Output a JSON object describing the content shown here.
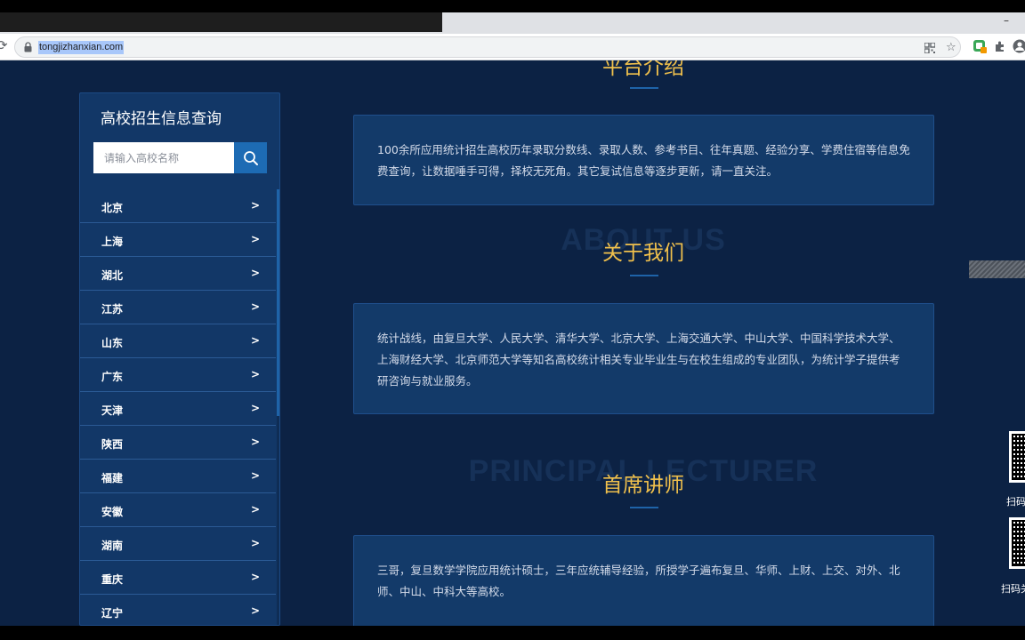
{
  "browser": {
    "url": "tongjizhanxian.com",
    "minimize_glyph": "–"
  },
  "sidebar": {
    "title": "高校招生信息查询",
    "search_placeholder": "请输入高校名称",
    "arrow": ">",
    "provinces": [
      "北京",
      "上海",
      "湖北",
      "江苏",
      "山东",
      "广东",
      "天津",
      "陕西",
      "福建",
      "安徽",
      "湖南",
      "重庆",
      "辽宁"
    ]
  },
  "sections": {
    "platform": {
      "title": "平台介绍",
      "text": "100余所应用统计招生高校历年录取分数线、录取人数、参考书目、往年真题、经验分享、学费住宿等信息免费查询，让数据唾手可得，择校无死角。其它复试信息等逐步更新，请一直关注。"
    },
    "about": {
      "bg_text": "ABOUT US",
      "title": "关于我们",
      "text": "统计战线，由复旦大学、人民大学、清华大学、北京大学、上海交通大学、中山大学、中国科学技术大学、上海财经大学、北京师范大学等知名高校统计相关专业毕业生与在校生组成的专业团队，为统计学子提供考研咨询与就业服务。"
    },
    "lecturer": {
      "bg_text": "PRINCIPAL LECTURER",
      "title": "首席讲师",
      "text": "三哥，复旦数学学院应用统计硕士，三年应统辅导经验，所授学子遍布复旦、华师、上财、上交、对外、北师、中山、中科大等高校。"
    }
  },
  "float_widgets": {
    "qr1_label": "扫码",
    "qr2_label": "扫码关"
  },
  "colors": {
    "page_bg": "#0c2244",
    "card_bg": "#133a69",
    "accent_gold": "#f0c04c",
    "accent_blue": "#1d6bb4"
  }
}
